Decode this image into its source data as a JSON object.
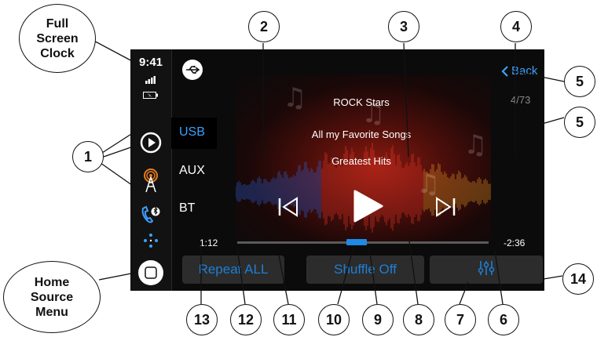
{
  "status": {
    "clock": "9:41"
  },
  "sources": {
    "usb": "USB",
    "aux": "AUX",
    "bt": "BT"
  },
  "nav": {
    "back_label": "Back",
    "track_count": "4/73"
  },
  "now_playing": {
    "artist": "ROCK Stars",
    "album": "All my Favorite Songs",
    "playlist": "Greatest Hits",
    "elapsed": "1:12",
    "remaining": "-2:36",
    "progress_fraction": 0.475
  },
  "controls": {
    "repeat_label": "Repeat ALL",
    "shuffle_label": "Shuffle Off"
  },
  "callouts": {
    "full_screen_clock": [
      "Full",
      "Screen",
      "Clock"
    ],
    "home_source_menu": [
      "Home",
      "Source",
      "Menu"
    ],
    "n1": "1",
    "n2": "2",
    "n3": "3",
    "n4": "4",
    "n5a": "5",
    "n5b": "5",
    "n6": "6",
    "n7": "7",
    "n8": "8",
    "n9": "9",
    "n10": "10",
    "n11": "11",
    "n12": "12",
    "n13": "13",
    "n14": "14"
  },
  "colors": {
    "accent": "#1e7fd6",
    "active_source": "#3ea0ff",
    "screen_bg": "#0b0b0b",
    "button_bg": "#2c2c2c"
  },
  "icons": {
    "usb": "usb-icon",
    "play_circle": "play-circle-icon",
    "radio_tower": "radio-tower-icon",
    "bt_phone": "bluetooth-phone-icon",
    "apps": "apps-dots-icon",
    "home": "home-button-icon",
    "prev": "skip-previous-icon",
    "play": "play-icon",
    "next": "skip-next-icon",
    "equalizer": "equalizer-icon"
  }
}
